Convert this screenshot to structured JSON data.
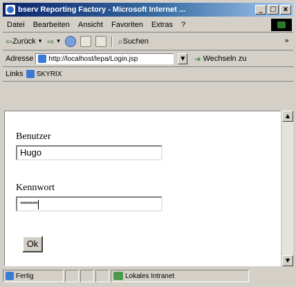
{
  "window": {
    "title": "bserv Reporting Factory - Microsoft Internet ..."
  },
  "titlebar_buttons": {
    "minimize": "_",
    "maximize": "□",
    "close": "x"
  },
  "menu": [
    "Datei",
    "Bearbeiten",
    "Ansicht",
    "Favoriten",
    "Extras",
    "?"
  ],
  "toolbar": {
    "back_label": "Zurück",
    "search_label": "Suchen",
    "more": "»"
  },
  "address": {
    "label": "Adresse",
    "value": "http://localhost/lepa/Login.jsp",
    "go_label": "Wechseln zu"
  },
  "links": {
    "label": "Links",
    "item": "SKYRIX"
  },
  "form": {
    "user_label": "Benutzer",
    "user_value": "Hugo",
    "password_label": "Kennwort",
    "password_value": "**********",
    "submit_label": "Ok"
  },
  "status": {
    "text": "Fertig",
    "zone": "Lokales Intranet"
  },
  "colors": {
    "titlebar_start": "#0a246a",
    "titlebar_end": "#a6caf0",
    "chrome": "#d4d0c8"
  }
}
